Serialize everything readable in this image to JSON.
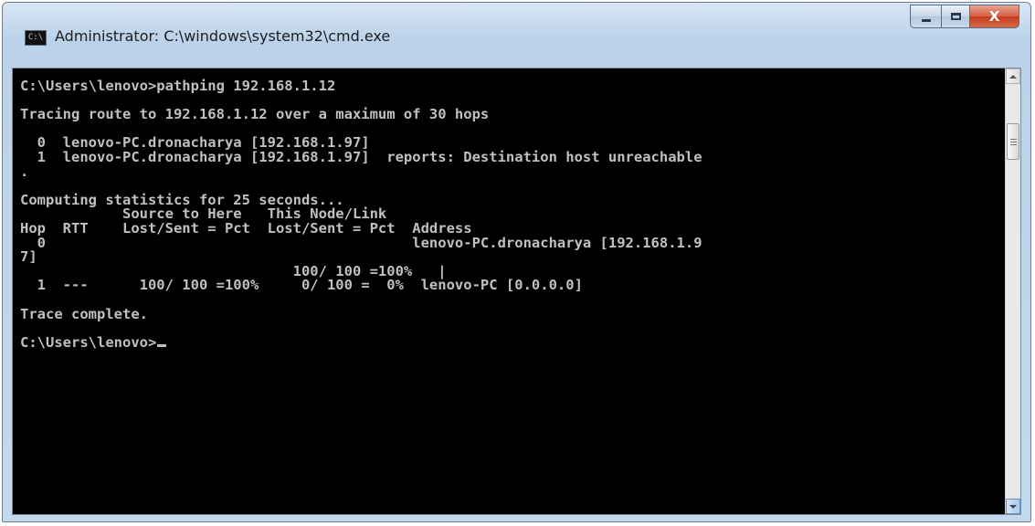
{
  "window": {
    "title": "Administrator: C:\\windows\\system32\\cmd.exe",
    "icon_label": "C:\\",
    "buttons": {
      "minimize": "minimize-icon",
      "maximize": "maximize-icon",
      "close_label": "X"
    }
  },
  "console": {
    "lines": [
      "C:\\Users\\lenovo>pathping 192.168.1.12",
      "",
      "Tracing route to 192.168.1.12 over a maximum of 30 hops",
      "",
      "  0  lenovo-PC.dronacharya [192.168.1.97]",
      "  1  lenovo-PC.dronacharya [192.168.1.97]  reports: Destination host unreachable",
      ".",
      "",
      "Computing statistics for 25 seconds...",
      "            Source to Here   This Node/Link",
      "Hop  RTT    Lost/Sent = Pct  Lost/Sent = Pct  Address",
      "  0                                           lenovo-PC.dronacharya [192.168.1.9",
      "7]",
      "                                100/ 100 =100%   |",
      "  1  ---      100/ 100 =100%     0/ 100 =  0%  lenovo-PC [0.0.0.0]",
      "",
      "Trace complete.",
      "",
      "C:\\Users\\lenovo>"
    ]
  },
  "colors": {
    "console_background": "#000000",
    "console_text": "#c0c0c0",
    "close_button": "#c53b1e"
  }
}
